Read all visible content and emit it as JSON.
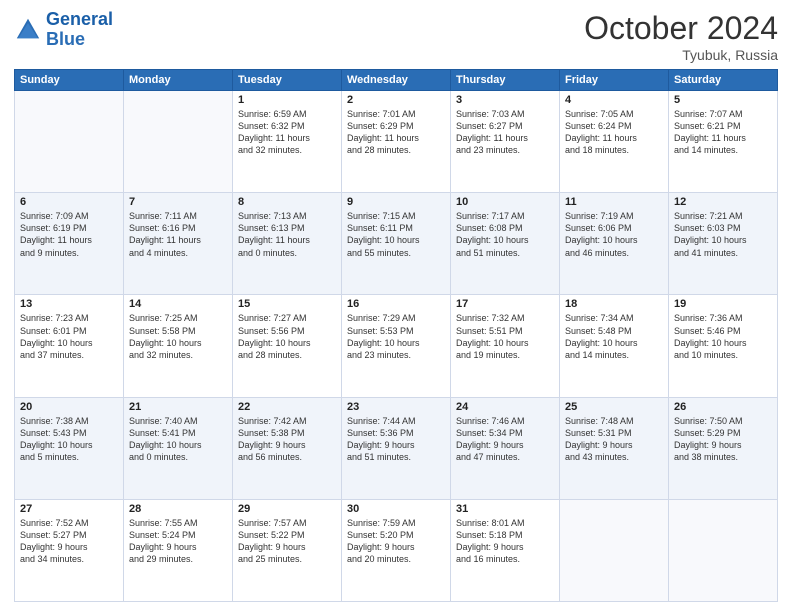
{
  "logo": {
    "line1": "General",
    "line2": "Blue"
  },
  "title": "October 2024",
  "location": "Tyubuk, Russia",
  "days_of_week": [
    "Sunday",
    "Monday",
    "Tuesday",
    "Wednesday",
    "Thursday",
    "Friday",
    "Saturday"
  ],
  "weeks": [
    [
      {
        "day": "",
        "content": ""
      },
      {
        "day": "",
        "content": ""
      },
      {
        "day": "1",
        "content": "Sunrise: 6:59 AM\nSunset: 6:32 PM\nDaylight: 11 hours\nand 32 minutes."
      },
      {
        "day": "2",
        "content": "Sunrise: 7:01 AM\nSunset: 6:29 PM\nDaylight: 11 hours\nand 28 minutes."
      },
      {
        "day": "3",
        "content": "Sunrise: 7:03 AM\nSunset: 6:27 PM\nDaylight: 11 hours\nand 23 minutes."
      },
      {
        "day": "4",
        "content": "Sunrise: 7:05 AM\nSunset: 6:24 PM\nDaylight: 11 hours\nand 18 minutes."
      },
      {
        "day": "5",
        "content": "Sunrise: 7:07 AM\nSunset: 6:21 PM\nDaylight: 11 hours\nand 14 minutes."
      }
    ],
    [
      {
        "day": "6",
        "content": "Sunrise: 7:09 AM\nSunset: 6:19 PM\nDaylight: 11 hours\nand 9 minutes."
      },
      {
        "day": "7",
        "content": "Sunrise: 7:11 AM\nSunset: 6:16 PM\nDaylight: 11 hours\nand 4 minutes."
      },
      {
        "day": "8",
        "content": "Sunrise: 7:13 AM\nSunset: 6:13 PM\nDaylight: 11 hours\nand 0 minutes."
      },
      {
        "day": "9",
        "content": "Sunrise: 7:15 AM\nSunset: 6:11 PM\nDaylight: 10 hours\nand 55 minutes."
      },
      {
        "day": "10",
        "content": "Sunrise: 7:17 AM\nSunset: 6:08 PM\nDaylight: 10 hours\nand 51 minutes."
      },
      {
        "day": "11",
        "content": "Sunrise: 7:19 AM\nSunset: 6:06 PM\nDaylight: 10 hours\nand 46 minutes."
      },
      {
        "day": "12",
        "content": "Sunrise: 7:21 AM\nSunset: 6:03 PM\nDaylight: 10 hours\nand 41 minutes."
      }
    ],
    [
      {
        "day": "13",
        "content": "Sunrise: 7:23 AM\nSunset: 6:01 PM\nDaylight: 10 hours\nand 37 minutes."
      },
      {
        "day": "14",
        "content": "Sunrise: 7:25 AM\nSunset: 5:58 PM\nDaylight: 10 hours\nand 32 minutes."
      },
      {
        "day": "15",
        "content": "Sunrise: 7:27 AM\nSunset: 5:56 PM\nDaylight: 10 hours\nand 28 minutes."
      },
      {
        "day": "16",
        "content": "Sunrise: 7:29 AM\nSunset: 5:53 PM\nDaylight: 10 hours\nand 23 minutes."
      },
      {
        "day": "17",
        "content": "Sunrise: 7:32 AM\nSunset: 5:51 PM\nDaylight: 10 hours\nand 19 minutes."
      },
      {
        "day": "18",
        "content": "Sunrise: 7:34 AM\nSunset: 5:48 PM\nDaylight: 10 hours\nand 14 minutes."
      },
      {
        "day": "19",
        "content": "Sunrise: 7:36 AM\nSunset: 5:46 PM\nDaylight: 10 hours\nand 10 minutes."
      }
    ],
    [
      {
        "day": "20",
        "content": "Sunrise: 7:38 AM\nSunset: 5:43 PM\nDaylight: 10 hours\nand 5 minutes."
      },
      {
        "day": "21",
        "content": "Sunrise: 7:40 AM\nSunset: 5:41 PM\nDaylight: 10 hours\nand 0 minutes."
      },
      {
        "day": "22",
        "content": "Sunrise: 7:42 AM\nSunset: 5:38 PM\nDaylight: 9 hours\nand 56 minutes."
      },
      {
        "day": "23",
        "content": "Sunrise: 7:44 AM\nSunset: 5:36 PM\nDaylight: 9 hours\nand 51 minutes."
      },
      {
        "day": "24",
        "content": "Sunrise: 7:46 AM\nSunset: 5:34 PM\nDaylight: 9 hours\nand 47 minutes."
      },
      {
        "day": "25",
        "content": "Sunrise: 7:48 AM\nSunset: 5:31 PM\nDaylight: 9 hours\nand 43 minutes."
      },
      {
        "day": "26",
        "content": "Sunrise: 7:50 AM\nSunset: 5:29 PM\nDaylight: 9 hours\nand 38 minutes."
      }
    ],
    [
      {
        "day": "27",
        "content": "Sunrise: 7:52 AM\nSunset: 5:27 PM\nDaylight: 9 hours\nand 34 minutes."
      },
      {
        "day": "28",
        "content": "Sunrise: 7:55 AM\nSunset: 5:24 PM\nDaylight: 9 hours\nand 29 minutes."
      },
      {
        "day": "29",
        "content": "Sunrise: 7:57 AM\nSunset: 5:22 PM\nDaylight: 9 hours\nand 25 minutes."
      },
      {
        "day": "30",
        "content": "Sunrise: 7:59 AM\nSunset: 5:20 PM\nDaylight: 9 hours\nand 20 minutes."
      },
      {
        "day": "31",
        "content": "Sunrise: 8:01 AM\nSunset: 5:18 PM\nDaylight: 9 hours\nand 16 minutes."
      },
      {
        "day": "",
        "content": ""
      },
      {
        "day": "",
        "content": ""
      }
    ]
  ]
}
